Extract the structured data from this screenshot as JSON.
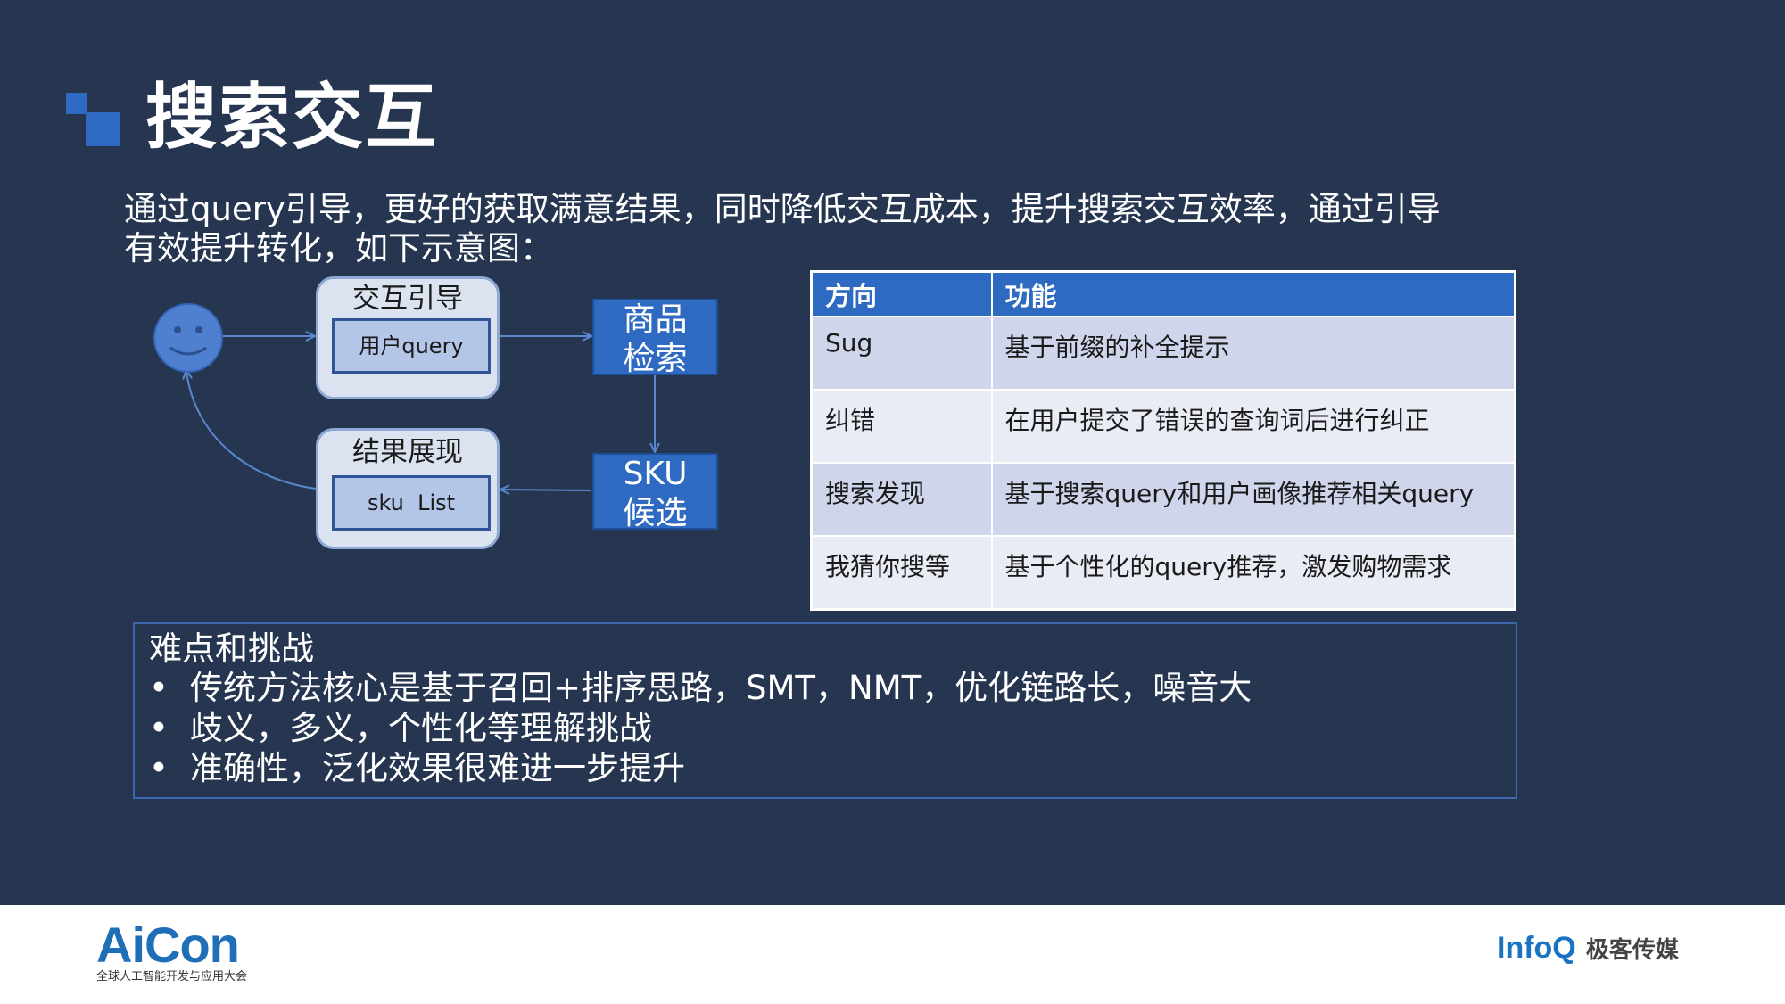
{
  "slide": {
    "title": "搜索交互",
    "intro_lines": [
      "通过query引导，更好的获取满意结果，同时降低交互成本，提升搜索交互效率，通过引导",
      "有效提升转化，如下示意图："
    ]
  },
  "diagram": {
    "guide_box": {
      "label": "交互引导",
      "inner": "用户query"
    },
    "result_box": {
      "label": "结果展现",
      "inner": "sku  List"
    },
    "search_box": [
      "商品",
      "检索"
    ],
    "sku_box": [
      "SKU",
      "候选"
    ]
  },
  "table": {
    "headers": [
      "方向",
      "功能"
    ],
    "rows": [
      [
        "Sug",
        "基于前缀的补全提示"
      ],
      [
        "纠错",
        "在用户提交了错误的查询词后进行纠正"
      ],
      [
        "搜索发现",
        "基于搜索query和用户画像推荐相关query"
      ],
      [
        "我猜你搜等",
        "基于个性化的query推荐，激发购物需求"
      ]
    ]
  },
  "challenges": {
    "heading": "难点和挑战",
    "bullet": "•",
    "items": [
      "传统方法核心是基于召回+排序思路，SMT，NMT，优化链路长，噪音大",
      "歧义，多义，个性化等理解挑战",
      "准确性，泛化效果很难进一步提升"
    ]
  },
  "footer": {
    "aicon_logo": "AiCon",
    "aicon_subtitle": "全球人工智能开发与应用大会",
    "infoq_logo": "InfoQ",
    "infoq_cn": "极客传媒"
  },
  "colors": {
    "background": "#263650",
    "accent_blue": "#2e6ac1",
    "logo_blue": "#1f6fb8",
    "infoq_blue": "#1a73c2"
  }
}
